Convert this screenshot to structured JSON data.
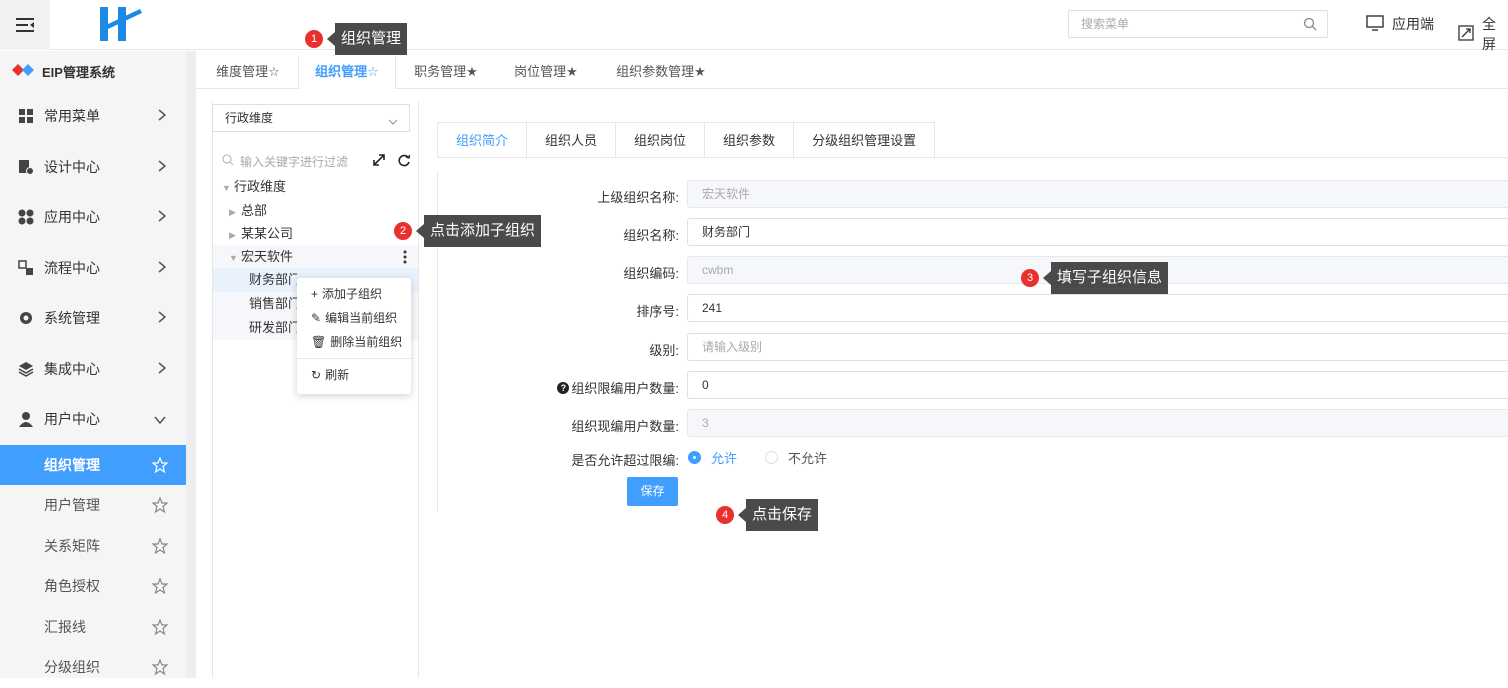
{
  "topbar": {
    "search_placeholder": "搜索菜单",
    "app_label": "应用端",
    "fullscreen_label": "全屏"
  },
  "sidebar": {
    "brand": "EIP管理系统",
    "menus": [
      {
        "label": "常用菜单",
        "icon": "grid-icon"
      },
      {
        "label": "设计中心",
        "icon": "design-icon"
      },
      {
        "label": "应用中心",
        "icon": "apps-icon"
      },
      {
        "label": "流程中心",
        "icon": "flow-icon"
      },
      {
        "label": "系统管理",
        "icon": "gear-icon"
      },
      {
        "label": "集成中心",
        "icon": "layers-icon"
      },
      {
        "label": "用户中心",
        "icon": "user-icon"
      }
    ],
    "submenus": [
      {
        "label": "组织管理",
        "active": true
      },
      {
        "label": "用户管理"
      },
      {
        "label": "关系矩阵"
      },
      {
        "label": "角色授权"
      },
      {
        "label": "汇报线"
      },
      {
        "label": "分级组织"
      }
    ]
  },
  "tabs": [
    {
      "label": "维度管理☆"
    },
    {
      "label": "组织管理☆"
    },
    {
      "label": "职务管理★"
    },
    {
      "label": "岗位管理★"
    },
    {
      "label": "组织参数管理★"
    }
  ],
  "tree": {
    "dimension": "行政维度",
    "filter_placeholder": "输入关键字进行过滤",
    "root": "行政维度",
    "nodes": [
      "总部",
      "某某公司",
      "宏天软件"
    ],
    "children": [
      "财务部门",
      "销售部门",
      "研发部门"
    ]
  },
  "context_menu": {
    "add": "添加子组织",
    "edit": "编辑当前组织",
    "delete": "删除当前组织",
    "refresh": "刷新"
  },
  "form_tabs": [
    "组织简介",
    "组织人员",
    "组织岗位",
    "组织参数",
    "分级组织管理设置"
  ],
  "form": {
    "parent_label": "上级组织名称:",
    "parent_value": "宏天软件",
    "name_label": "组织名称:",
    "name_value": "财务部门",
    "code_label": "组织编码:",
    "code_value": "cwbm",
    "sort_label": "排序号:",
    "sort_value": "241",
    "level_label": "级别:",
    "level_placeholder": "请输入级别",
    "limit_label": "组织限编用户数量:",
    "limit_value": "0",
    "current_label": "组织现编用户数量:",
    "current_value": "3",
    "allow_label": "是否允许超过限编:",
    "allow_yes": "允许",
    "allow_no": "不允许",
    "save": "保存"
  },
  "callouts": [
    {
      "num": "1",
      "text": "组织管理"
    },
    {
      "num": "2",
      "text": "点击添加子组织"
    },
    {
      "num": "3",
      "text": "填写子组织信息"
    },
    {
      "num": "4",
      "text": "点击保存"
    }
  ],
  "colors": {
    "accent": "#409eff",
    "callout_bg": "#4a4a4a",
    "badge": "#e8312f"
  }
}
